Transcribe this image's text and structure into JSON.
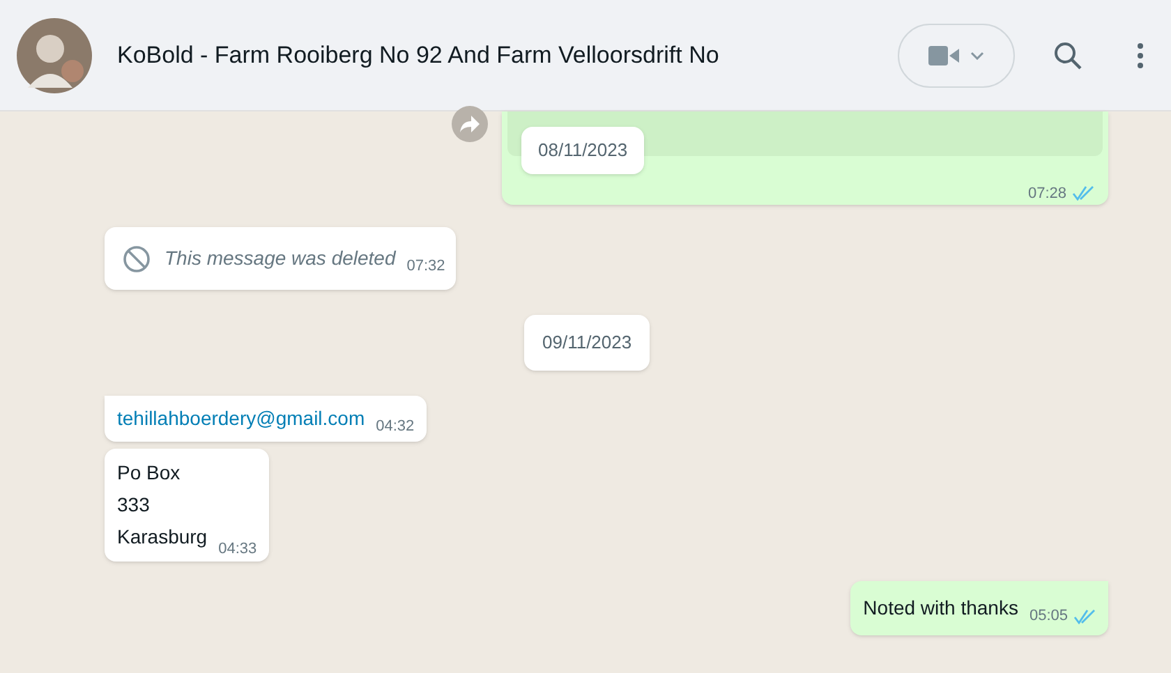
{
  "header": {
    "title": "KoBold - Farm Rooiberg No 92 And Farm Velloorsdrift No"
  },
  "messages": [
    {
      "kind": "file",
      "outgoing": true,
      "date_chip": "08/11/2023",
      "time": "07:28",
      "read": true
    },
    {
      "kind": "deleted",
      "outgoing": false,
      "text": "This message was deleted",
      "time": "07:32"
    },
    {
      "kind": "date",
      "text": "09/11/2023"
    },
    {
      "kind": "link",
      "outgoing": false,
      "text": "tehillahboerdery@gmail.com",
      "time": "04:32",
      "tail": true
    },
    {
      "kind": "lines",
      "outgoing": false,
      "lines": [
        "Po Box",
        "333",
        "Karasburg"
      ],
      "time": "04:33",
      "tail": false
    },
    {
      "kind": "text",
      "outgoing": true,
      "text": "Noted with thanks",
      "time": "05:05",
      "read": true,
      "tail": true
    }
  ]
}
